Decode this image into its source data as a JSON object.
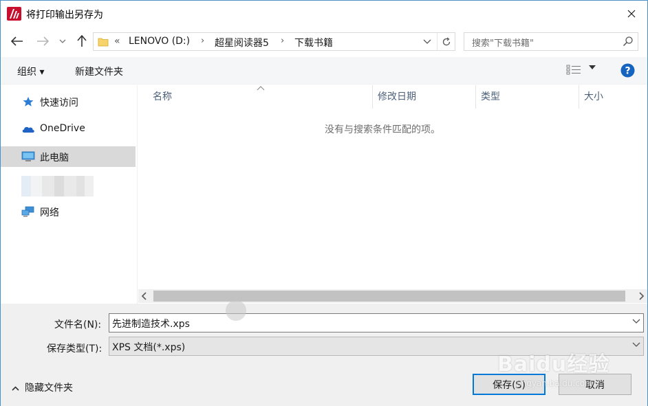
{
  "window": {
    "title": "将打印输出另存为"
  },
  "nav": {
    "breadcrumbs": [
      {
        "label": "«"
      },
      {
        "label": "LENOVO (D:)"
      },
      {
        "label": "超星阅读器5"
      },
      {
        "label": "下载书籍"
      }
    ],
    "search_placeholder": "搜索\"下载书籍\""
  },
  "toolbar": {
    "organize": "组织 ▾",
    "new_folder": "新建文件夹"
  },
  "sidebar": {
    "items": [
      {
        "label": "快速访问",
        "icon": "star-icon"
      },
      {
        "label": "OneDrive",
        "icon": "cloud-icon"
      },
      {
        "label": "此电脑",
        "icon": "computer-icon",
        "selected": true
      },
      {
        "label": "网络",
        "icon": "network-icon"
      }
    ]
  },
  "filelist": {
    "columns": [
      "名称",
      "修改日期",
      "类型",
      "大小"
    ],
    "empty_message": "没有与搜索条件匹配的项。"
  },
  "form": {
    "filename_label": "文件名(N):",
    "filename_value": "先进制造技术.xps",
    "filetype_label": "保存类型(T):",
    "filetype_value": "XPS 文档(*.xps)"
  },
  "footer": {
    "hide_folders": "隐藏文件夹",
    "save_button": "保存(S)",
    "cancel_button": "取消"
  },
  "watermark": {
    "brand": "Baidu经验",
    "url": "jingyan.baidu.com"
  },
  "colors": {
    "accent": "#0078d7",
    "selected": "#d9d9d9",
    "app_icon": "#c8102e"
  }
}
